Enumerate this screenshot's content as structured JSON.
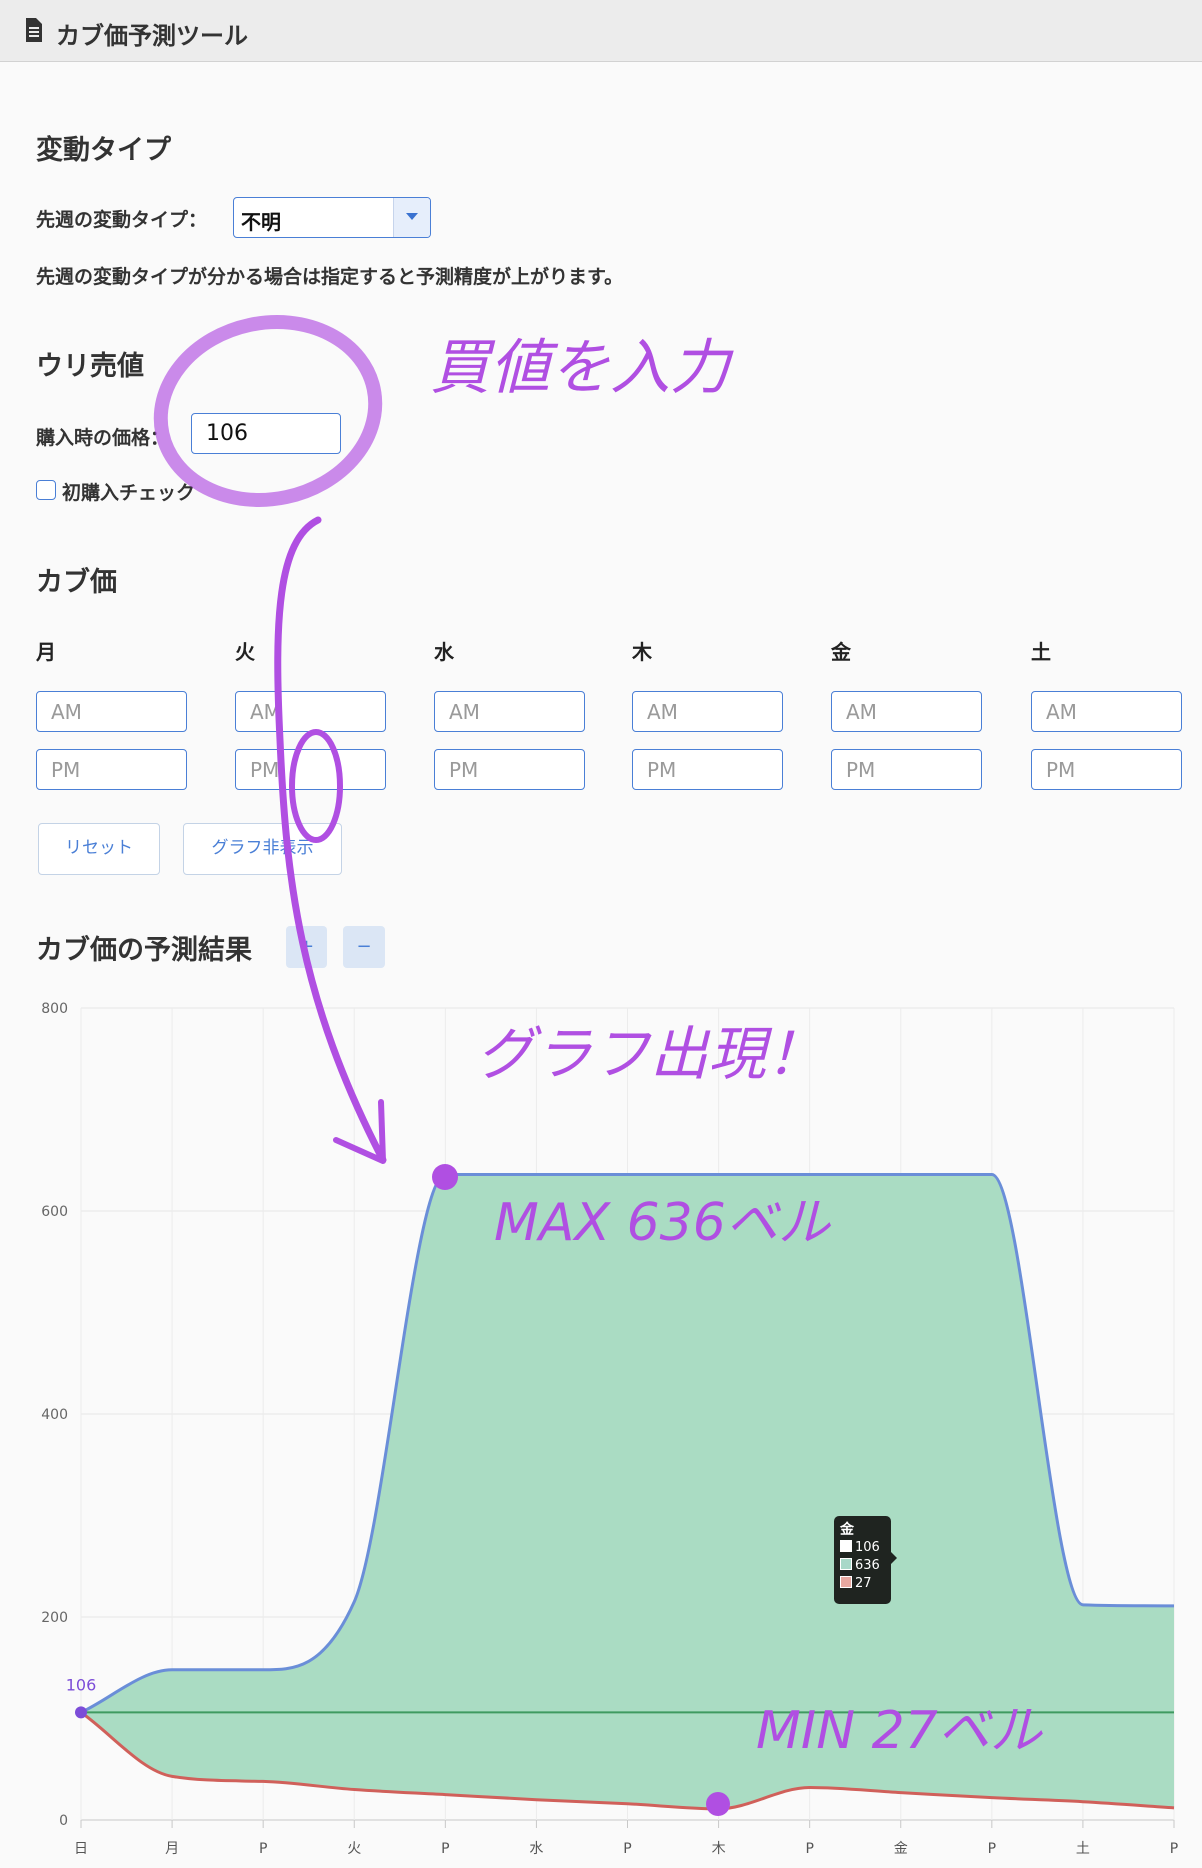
{
  "app": {
    "title": "カブ価予測ツール",
    "icon": "document-icon"
  },
  "pattern": {
    "heading": "変動タイプ",
    "label": "先週の変動タイプ：",
    "selected": "不明",
    "note": "先週の変動タイプが分かる場合は指定すると予測精度が上がります。"
  },
  "sell": {
    "heading": "ウリ売値",
    "label": "購入時の価格：",
    "value": "106",
    "first_buy_label": "初購入チェック",
    "first_buy_checked": false
  },
  "prices": {
    "heading": "カブ価",
    "days": [
      {
        "label": "月",
        "am_placeholder": "AM",
        "pm_placeholder": "PM"
      },
      {
        "label": "火",
        "am_placeholder": "AM",
        "pm_placeholder": "PM"
      },
      {
        "label": "水",
        "am_placeholder": "AM",
        "pm_placeholder": "PM"
      },
      {
        "label": "木",
        "am_placeholder": "AM",
        "pm_placeholder": "PM"
      },
      {
        "label": "金",
        "am_placeholder": "AM",
        "pm_placeholder": "PM"
      },
      {
        "label": "土",
        "am_placeholder": "AM",
        "pm_placeholder": "PM"
      }
    ],
    "reset_label": "リセット",
    "toggle_graph_label": "グラフ非表示"
  },
  "result": {
    "heading": "カブ価の予測結果",
    "zoom_in_label": "+",
    "zoom_out_label": "−"
  },
  "chart_data": {
    "type": "area",
    "categories": [
      "日",
      "月",
      "P",
      "火",
      "P",
      "水",
      "P",
      "木",
      "P",
      "金",
      "P",
      "土",
      "P"
    ],
    "series": [
      {
        "values": [
          106,
          148,
          148,
          215,
          636,
          636,
          636,
          636,
          636,
          636,
          636,
          212,
          211
        ],
        "color": "#6a8ed8"
      },
      {
        "values": [
          106,
          43,
          38,
          30,
          25,
          20,
          16,
          11,
          32,
          27,
          22,
          18,
          12
        ],
        "color": "#d0605a"
      },
      {
        "values": [
          106,
          106,
          106,
          106,
          106,
          106,
          106,
          106,
          106,
          106,
          106,
          106,
          106
        ],
        "color": "#3f9a60"
      }
    ],
    "data_label": "106",
    "yticks": [
      0,
      200,
      400,
      600,
      800
    ],
    "ylim": [
      0,
      800
    ],
    "grid": true
  },
  "tooltip": {
    "title": "金",
    "rows": [
      {
        "value": "106",
        "color": "#ffffff"
      },
      {
        "value": "636",
        "color": "#a8d8c8"
      },
      {
        "value": "27",
        "color": "#e8a8a0"
      }
    ]
  },
  "annotations": {
    "buy_price": "買値を入力",
    "graph_appears": "グラフ出現！",
    "max": "MAX 636ベル",
    "min": "MIN 27ベル"
  },
  "colors": {
    "accent": "#4a7fd6",
    "area_fill": "#aadcc3",
    "annotation": "#b04fe2",
    "first_point": "#7c4dd8"
  }
}
